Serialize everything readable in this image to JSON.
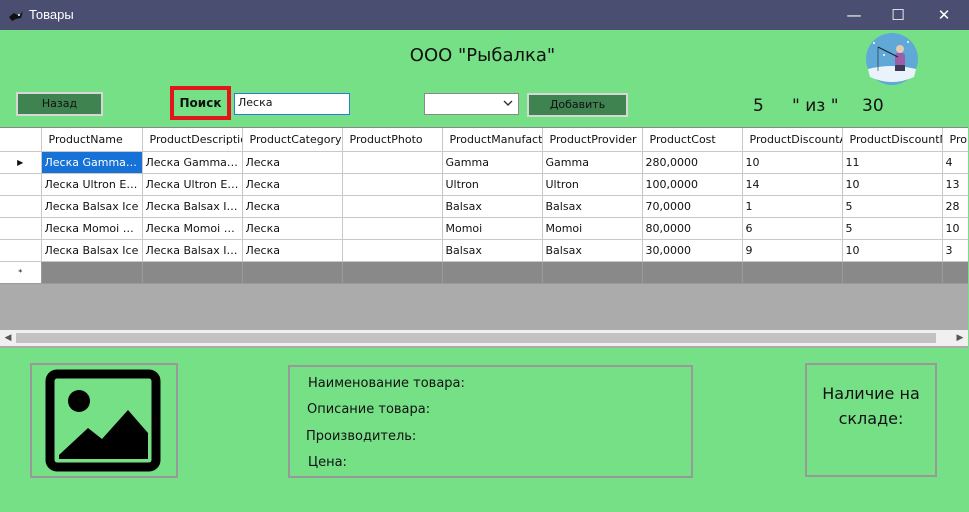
{
  "window": {
    "title": "Товары",
    "controls": [
      "—",
      "☐",
      "✕"
    ]
  },
  "header": {
    "company": "ООО \"Рыбалка\""
  },
  "toolbar": {
    "back_label": "Назад",
    "search_label": "Поиск",
    "search_value": "Леска",
    "filter_value": "",
    "add_label": "Добавить",
    "shown_count": "5",
    "of_label": "\" из \"",
    "total_count": "30"
  },
  "grid": {
    "columns": [
      "ProductName",
      "ProductDescriptic",
      "ProductCategory",
      "ProductPhoto",
      "ProductManufactı",
      "ProductProvider",
      "ProductCost",
      "ProductDiscountA",
      "ProductDiscountM",
      "Pro"
    ],
    "rows": [
      [
        "Леска Gamma I...",
        "Леска Gamma I...",
        "Леска",
        "",
        "Gamma",
        "Gamma",
        "280,0000",
        "10",
        "11",
        "4"
      ],
      [
        "Леска Ultron Eli...",
        "Леска Ultron Eli...",
        "Леска",
        "",
        "Ultron",
        "Ultron",
        "100,0000",
        "14",
        "10",
        "13"
      ],
      [
        "Леска  Balsax Ice",
        "Леска Balsax Ic...",
        "Леска",
        "",
        "Balsax",
        "Balsax",
        "70,0000",
        "1",
        "5",
        "28"
      ],
      [
        "Леска Momoi Hi...",
        "Леска Momoi Hi...",
        "Леска",
        "",
        "Momoi",
        "Momoi",
        "80,0000",
        "6",
        "5",
        "10"
      ],
      [
        "Леска Balsax Ice",
        "Леска Balsax Ic...",
        "Леска",
        "",
        "Balsax",
        "Balsax",
        "30,0000",
        "9",
        "10",
        "3"
      ]
    ],
    "current_row_marker": "▶",
    "new_row_marker": "*"
  },
  "details": {
    "name_label": "Наименование товара:",
    "description_label": "Описание товара:",
    "manufacturer_label": "Производитель:",
    "price_label": "Цена:",
    "stock_label": "Наличие на складе:"
  },
  "colors": {
    "background": "#76e086",
    "titlebar": "#4a4f72",
    "button": "#3e8350",
    "highlight_border": "#e0161a",
    "selection": "#1672d6"
  },
  "icons": [
    "fish-app-icon",
    "minimize-icon",
    "maximize-icon",
    "close-icon",
    "chevron-down-icon",
    "image-placeholder-icon",
    "fisherman-logo"
  ]
}
